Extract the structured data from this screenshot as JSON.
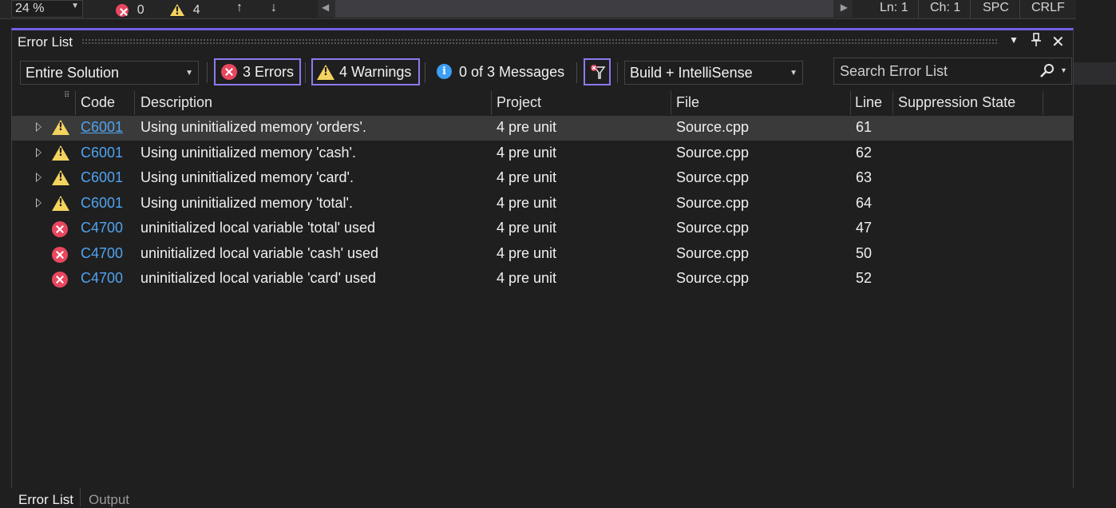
{
  "editor_status": {
    "zoom": "24 %",
    "error_count": "0",
    "warning_count": "4",
    "line": "Ln: 1",
    "char": "Ch: 1",
    "whitespace": "SPC",
    "line_ending": "CRLF"
  },
  "panel": {
    "title": "Error List"
  },
  "toolbar": {
    "scope": "Entire Solution",
    "errors_label": "3 Errors",
    "warnings_label": "4 Warnings",
    "messages_label": "0 of 3 Messages",
    "source_filter": "Build + IntelliSense",
    "search_placeholder": "Search Error List"
  },
  "columns": {
    "code": "Code",
    "description": "Description",
    "project": "Project",
    "file": "File",
    "line": "Line",
    "suppression": "Suppression State"
  },
  "rows": [
    {
      "severity": "warning",
      "code": "C6001",
      "description": "Using uninitialized memory 'orders'.",
      "project": "4 pre unit",
      "file": "Source.cpp",
      "line": "61",
      "expandable": true,
      "selected": true
    },
    {
      "severity": "warning",
      "code": "C6001",
      "description": "Using uninitialized memory 'cash'.",
      "project": "4 pre unit",
      "file": "Source.cpp",
      "line": "62",
      "expandable": true
    },
    {
      "severity": "warning",
      "code": "C6001",
      "description": "Using uninitialized memory 'card'.",
      "project": "4 pre unit",
      "file": "Source.cpp",
      "line": "63",
      "expandable": true
    },
    {
      "severity": "warning",
      "code": "C6001",
      "description": "Using uninitialized memory 'total'.",
      "project": "4 pre unit",
      "file": "Source.cpp",
      "line": "64",
      "expandable": true
    },
    {
      "severity": "error",
      "code": "C4700",
      "description": "uninitialized local variable 'total' used",
      "project": "4 pre unit",
      "file": "Source.cpp",
      "line": "47",
      "expandable": false
    },
    {
      "severity": "error",
      "code": "C4700",
      "description": "uninitialized local variable 'cash' used",
      "project": "4 pre unit",
      "file": "Source.cpp",
      "line": "50",
      "expandable": false
    },
    {
      "severity": "error",
      "code": "C4700",
      "description": "uninitialized local variable 'card' used",
      "project": "4 pre unit",
      "file": "Source.cpp",
      "line": "52",
      "expandable": false
    }
  ],
  "bottom_tabs": [
    "Error List",
    "Output"
  ],
  "colors": {
    "accent": "#7160e8",
    "error": "#e8475f",
    "warning": "#f4d35e",
    "info": "#3c9ef5",
    "link": "#4fa3f0"
  }
}
